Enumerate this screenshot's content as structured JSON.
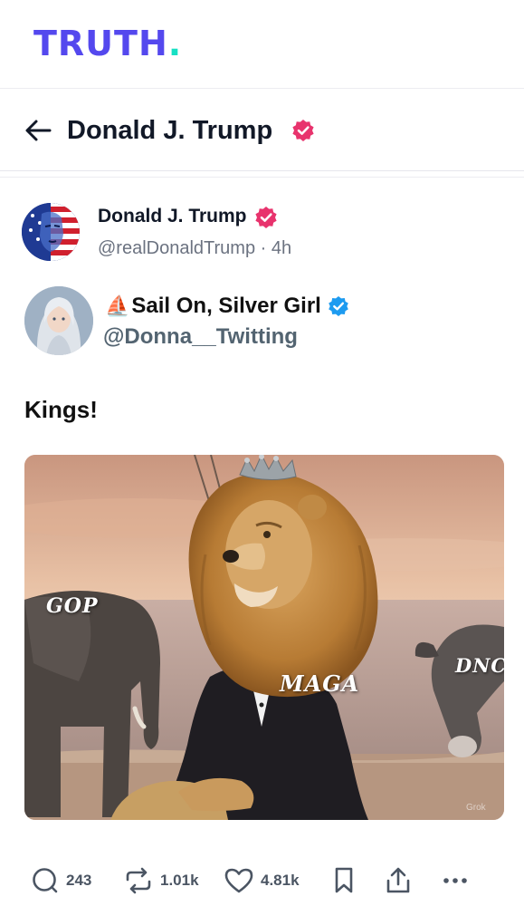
{
  "brand": {
    "logo_text": "TRUTH",
    "logo_dot": ".",
    "color": "#5448ee",
    "dot_color": "#17e0c4"
  },
  "header": {
    "title": "Donald J. Trump",
    "back_icon": "arrow-left-icon",
    "verified_color": "#e8336d"
  },
  "post": {
    "author_name": "Donald J. Trump",
    "handle": "@realDonaldTrump",
    "separator": "·",
    "time": "4h",
    "text": "Kings!"
  },
  "embedded": {
    "emoji": "⛵",
    "name": "Sail On, Silver Girl",
    "handle": "@Donna__Twitting",
    "verified_color": "#1d9bf0"
  },
  "meme": {
    "labels": {
      "left": "GOP",
      "center": "MAGA",
      "right": "DNC"
    },
    "watermark": "Grok"
  },
  "actions": {
    "replies": "243",
    "retruths": "1.01k",
    "likes": "4.81k",
    "icons": [
      "comment-icon",
      "retruth-icon",
      "heart-icon",
      "bookmark-icon",
      "share-icon",
      "more-icon"
    ]
  }
}
